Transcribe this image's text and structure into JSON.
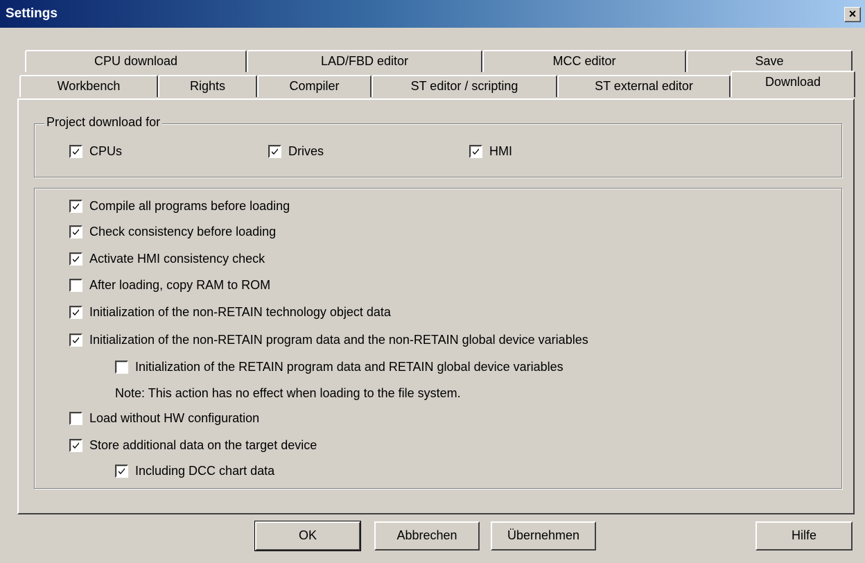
{
  "window": {
    "title": "Settings",
    "close_label": "×"
  },
  "tabs_row1": [
    {
      "label": "CPU download"
    },
    {
      "label": "LAD/FBD editor"
    },
    {
      "label": "MCC editor"
    },
    {
      "label": "Save"
    }
  ],
  "tabs_row2": [
    {
      "label": "Workbench"
    },
    {
      "label": "Rights"
    },
    {
      "label": "Compiler"
    },
    {
      "label": "ST editor / scripting"
    },
    {
      "label": "ST external editor"
    },
    {
      "label": "Download",
      "active": true
    }
  ],
  "project_download": {
    "title": "Project download for",
    "items": [
      {
        "label": "CPUs",
        "checked": true
      },
      {
        "label": "Drives",
        "checked": true
      },
      {
        "label": "HMI",
        "checked": true
      }
    ]
  },
  "options": [
    {
      "label": "Compile all programs before loading",
      "checked": true
    },
    {
      "label": "Check consistency before loading",
      "checked": true
    },
    {
      "label": "Activate HMI consistency check",
      "checked": true
    },
    {
      "label": "After loading, copy RAM to ROM",
      "checked": false
    },
    {
      "label": "Initialization of the non-RETAIN technology object data",
      "checked": true
    },
    {
      "label": "Initialization of the non-RETAIN program data and the non-RETAIN global device variables",
      "checked": true
    },
    {
      "label": "Initialization of the RETAIN program data and RETAIN global device variables",
      "checked": false
    },
    {
      "label": "Load without HW configuration",
      "checked": false
    },
    {
      "label": "Store additional data on the target device",
      "checked": true
    },
    {
      "label": "Including DCC chart data",
      "checked": true
    }
  ],
  "note": "Note: This action has no effect when loading to the file system.",
  "buttons": {
    "ok": "OK",
    "cancel": "Abbrechen",
    "apply": "Übernehmen",
    "help": "Hilfe"
  }
}
